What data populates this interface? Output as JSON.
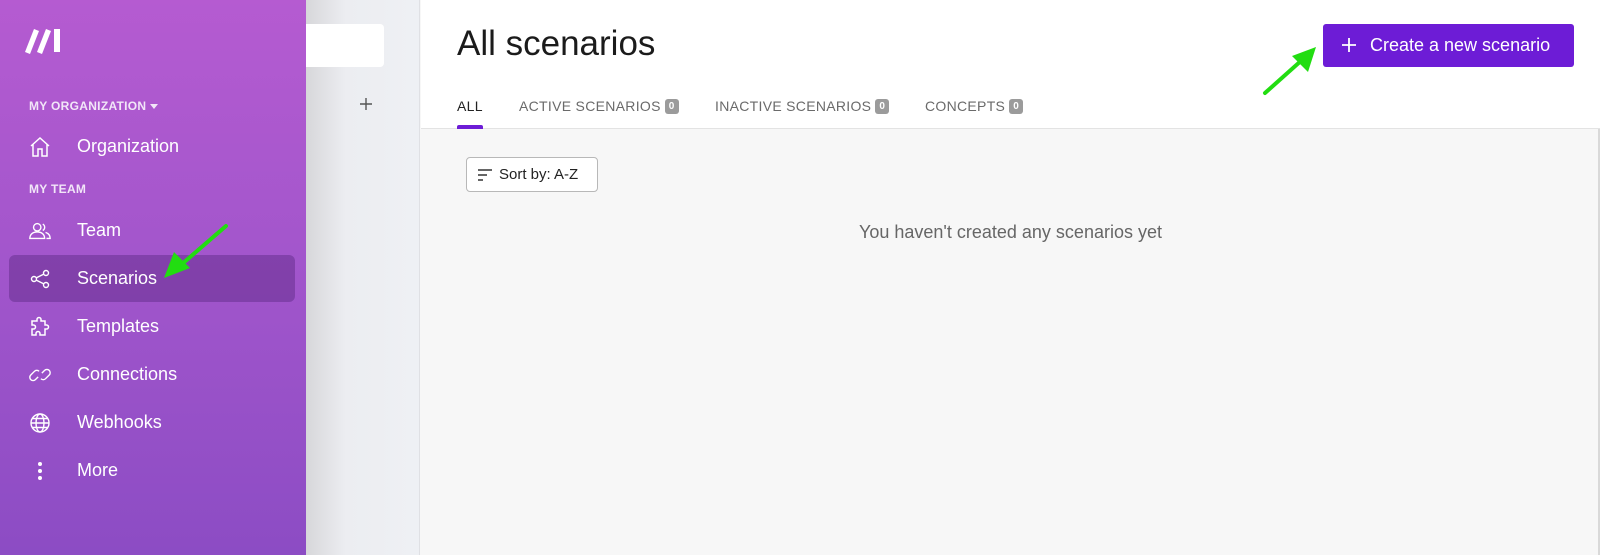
{
  "sidebar": {
    "org_label": "MY ORGANIZATION",
    "team_label": "MY TEAM",
    "items": [
      {
        "label": "Organization",
        "icon": "home-icon"
      },
      {
        "label": "Team",
        "icon": "users-icon"
      },
      {
        "label": "Scenarios",
        "icon": "share-nodes-icon",
        "active": true
      },
      {
        "label": "Templates",
        "icon": "puzzle-icon"
      },
      {
        "label": "Connections",
        "icon": "link-icon"
      },
      {
        "label": "Webhooks",
        "icon": "globe-icon"
      },
      {
        "label": "More",
        "icon": "more-vertical-icon"
      }
    ]
  },
  "main": {
    "title": "All scenarios",
    "create_button": "Create a new scenario",
    "tabs": [
      {
        "label": "ALL",
        "count": null,
        "active": true
      },
      {
        "label": "ACTIVE SCENARIOS",
        "count": "0"
      },
      {
        "label": "INACTIVE SCENARIOS",
        "count": "0"
      },
      {
        "label": "CONCEPTS",
        "count": "0"
      }
    ],
    "sort_label": "Sort by: A-Z",
    "empty_message": "You haven't created any scenarios yet"
  },
  "colors": {
    "accent": "#6d1cd6",
    "sidebar_top": "#b55bd1",
    "sidebar_bottom": "#8c4cc4",
    "annotation_arrow": "#22dd11"
  }
}
